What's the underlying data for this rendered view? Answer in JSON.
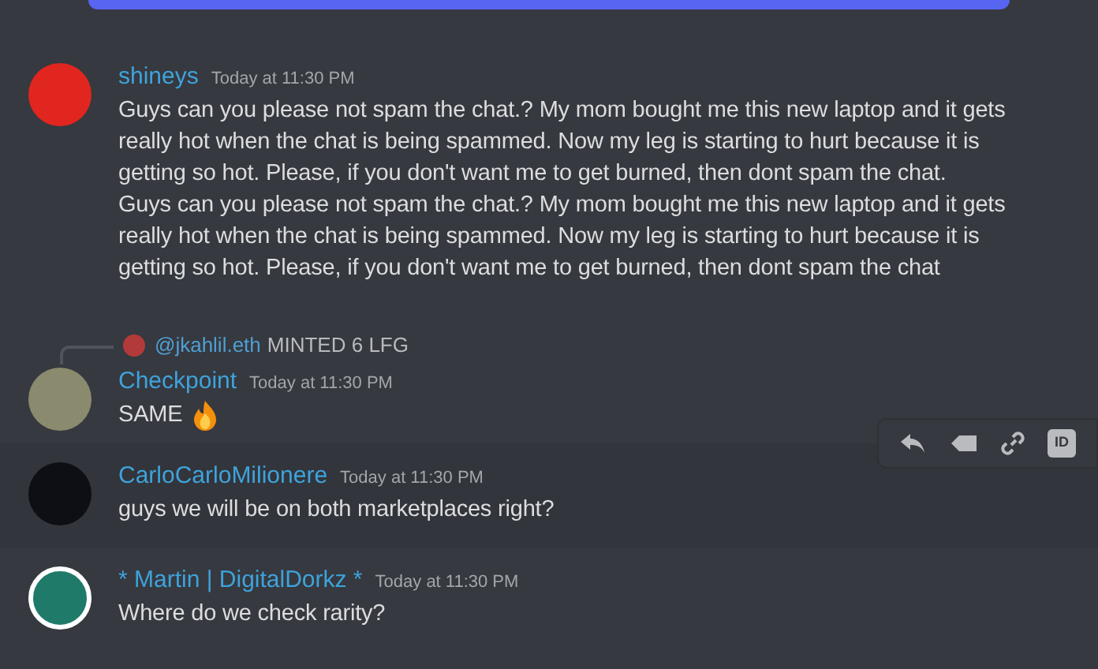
{
  "messages": [
    {
      "author": "shineys",
      "time": "Today at 11:30 PM",
      "paragraphs": [
        "Guys can you please not spam the chat.? My mom bought me this new laptop and it gets really hot when the chat is being spammed. Now my leg is starting to hurt because it is getting so hot. Please, if you don't want me to get burned, then dont spam the chat.",
        "Guys can you please not spam the chat.? My mom bought me this new laptop and it gets really hot when the chat is being spammed. Now my leg is starting to hurt because it is getting so hot. Please, if you don't want me to get burned, then dont spam the chat"
      ],
      "hovered": false
    },
    {
      "author": "Checkpoint",
      "time": "Today at 11:30 PM",
      "reply": {
        "mention": "@jkahlil.eth",
        "text": "MINTED 6 LFG"
      },
      "paragraphs": [
        "SAME"
      ],
      "fire_emoji": true,
      "hovered": false
    },
    {
      "author": "CarloCarloMilionere",
      "time": "Today at 11:30 PM",
      "paragraphs": [
        "guys we will be on both marketplaces right?"
      ],
      "hovered": true,
      "id_badge": "ID"
    },
    {
      "author": "* Martin | DigitalDorkz *",
      "time": "Today at 11:30 PM",
      "paragraphs": [
        "Where do we check rarity?"
      ],
      "hovered": false
    }
  ]
}
